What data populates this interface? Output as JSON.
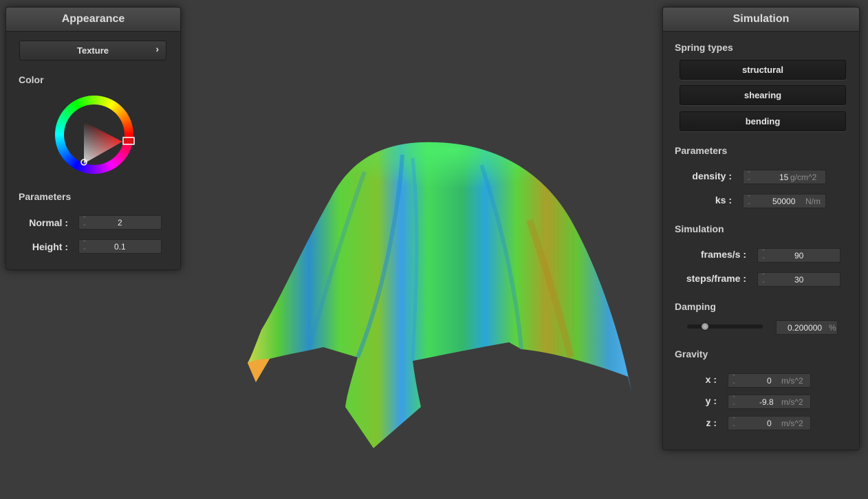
{
  "colors": {
    "background": "#3c3c3c",
    "panel": "#2d2d2d",
    "wheel_selected": "#ff0000",
    "cloth_green": "#2ee05a",
    "cloth_blue": "#3fa0ff",
    "cloth_orange": "#ffa83a"
  },
  "appearance": {
    "title": "Appearance",
    "texture_button": "Texture",
    "texture_arrow": "›",
    "color_label": "Color",
    "params_label": "Parameters",
    "normal_label": "Normal :",
    "normal_value": "2",
    "height_label": "Height :",
    "height_value": "0.1"
  },
  "simulation": {
    "title": "Simulation",
    "spring_label": "Spring types",
    "spring_types": [
      "structural",
      "shearing",
      "bending"
    ],
    "params_label": "Parameters",
    "density_label": "density :",
    "density_value": "15",
    "density_unit": "g/cm^2",
    "ks_label": "ks :",
    "ks_value": "50000",
    "ks_unit": "N/m",
    "sim_label": "Simulation",
    "fps_label": "frames/s :",
    "fps_value": "90",
    "steps_label": "steps/frame :",
    "steps_value": "30",
    "damping_label": "Damping",
    "damping_value": "0.200000",
    "damping_unit": "%",
    "damping_level": 0.2,
    "gravity_label": "Gravity",
    "gx_label": "x :",
    "gx_value": "0",
    "gy_label": "y :",
    "gy_value": "-9.8",
    "gz_label": "z :",
    "gz_value": "0",
    "gravity_unit": "m/s^2"
  },
  "icons": {
    "spin": "up-down-arrows-icon"
  }
}
